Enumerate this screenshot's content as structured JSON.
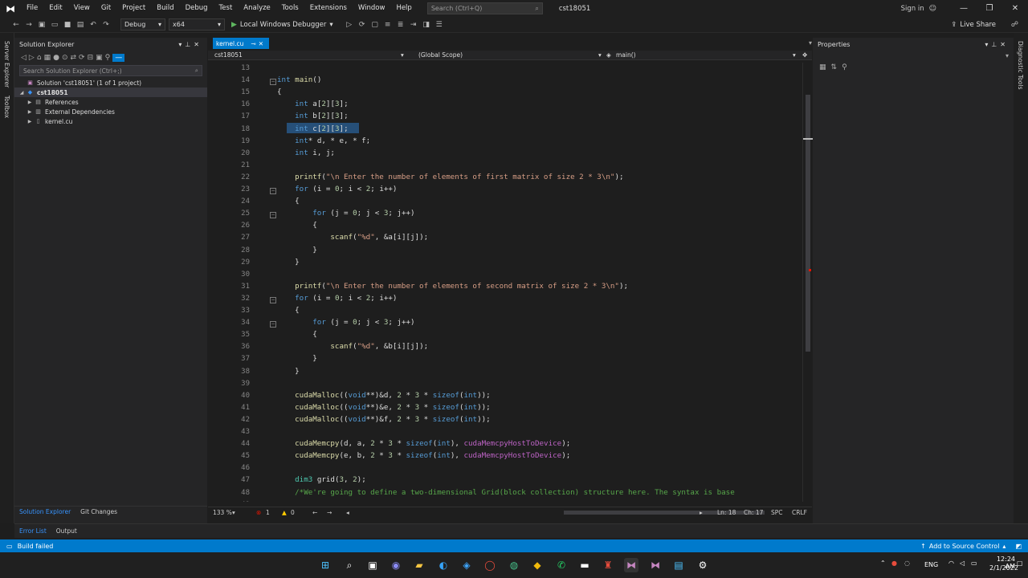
{
  "menubar": {
    "items": [
      "File",
      "Edit",
      "View",
      "Git",
      "Project",
      "Build",
      "Debug",
      "Test",
      "Analyze",
      "Tools",
      "Extensions",
      "Window",
      "Help"
    ],
    "search_placeholder": "Search (Ctrl+Q)",
    "window_title": "cst18051",
    "sign_in": "Sign in"
  },
  "toolbar": {
    "configuration": "Debug",
    "platform": "x64",
    "run_label": "Local Windows Debugger",
    "live_share": "Live Share"
  },
  "left_strip": {
    "labels": [
      "Server Explorer",
      "Toolbox"
    ]
  },
  "right_strip": {
    "labels": [
      "Diagnostic Tools"
    ]
  },
  "solution_explorer": {
    "title": "Solution Explorer",
    "search_placeholder": "Search Solution Explorer (Ctrl+;)",
    "tree": [
      {
        "label": "Solution 'cst18051' (1 of 1 project)",
        "indent": 0
      },
      {
        "label": "cst18051",
        "indent": 1,
        "selected": true
      },
      {
        "label": "References",
        "indent": 2
      },
      {
        "label": "External Dependencies",
        "indent": 2
      },
      {
        "label": "kernel.cu",
        "indent": 2
      }
    ],
    "tabs": [
      "Solution Explorer",
      "Git Changes"
    ]
  },
  "editor": {
    "tab_label": "kernel.cu",
    "nav_project": "cst18051",
    "nav_scope": "(Global Scope)",
    "nav_function": "main()",
    "line_numbers": [
      13,
      14,
      15,
      16,
      17,
      18,
      19,
      20,
      21,
      22,
      23,
      24,
      25,
      26,
      27,
      28,
      29,
      30,
      31,
      32,
      33,
      34,
      35,
      36,
      37,
      38,
      39,
      40,
      41,
      42,
      43,
      44,
      45,
      46,
      47,
      48,
      49
    ],
    "lines": [
      "",
      "int main()",
      "{",
      "    int a[2][3];",
      "    int b[2][3];",
      "    int c[2][3];",
      "    int* d, * e, * f;",
      "    int i, j;",
      "",
      "    printf(\"\\n Enter the number of elements of first matrix of size 2 * 3\\n\");",
      "    for (i = 0; i < 2; i++)",
      "    {",
      "        for (j = 0; j < 3; j++)",
      "        {",
      "            scanf(\"%d\", &a[i][j]);",
      "        }",
      "    }",
      "",
      "    printf(\"\\n Enter the number of elements of second matrix of size 2 * 3\\n\");",
      "    for (i = 0; i < 2; i++)",
      "    {",
      "        for (j = 0; j < 3; j++)",
      "        {",
      "            scanf(\"%d\", &b[i][j]);",
      "        }",
      "    }",
      "",
      "    cudaMalloc((void**)&d, 2 * 3 * sizeof(int));",
      "    cudaMalloc((void**)&e, 2 * 3 * sizeof(int));",
      "    cudaMalloc((void**)&f, 2 * 3 * sizeof(int));",
      "",
      "    cudaMemcpy(d, a, 2 * 3 * sizeof(int), cudaMemcpyHostToDevice);",
      "    cudaMemcpy(e, b, 2 * 3 * sizeof(int), cudaMemcpyHostToDevice);",
      "",
      "    dim3 grid(3, 2);",
      "    /*We're going to define a two-dimensional Grid(block collection) structure here. The syntax is base",
      ""
    ],
    "zoom": "133 %",
    "errors": "1",
    "warnings": "0",
    "ln": "Ln: 18",
    "ch": "Ch: 17",
    "spc": "SPC",
    "eol": "CRLF"
  },
  "properties": {
    "title": "Properties"
  },
  "bottom_tabs": [
    "Error List",
    "Output"
  ],
  "statusbar": {
    "left": "Build failed",
    "right": "Add to Source Control"
  },
  "taskbar": {
    "lang": "ENG",
    "time": "12:24 AM",
    "date": "2/1/2022"
  }
}
